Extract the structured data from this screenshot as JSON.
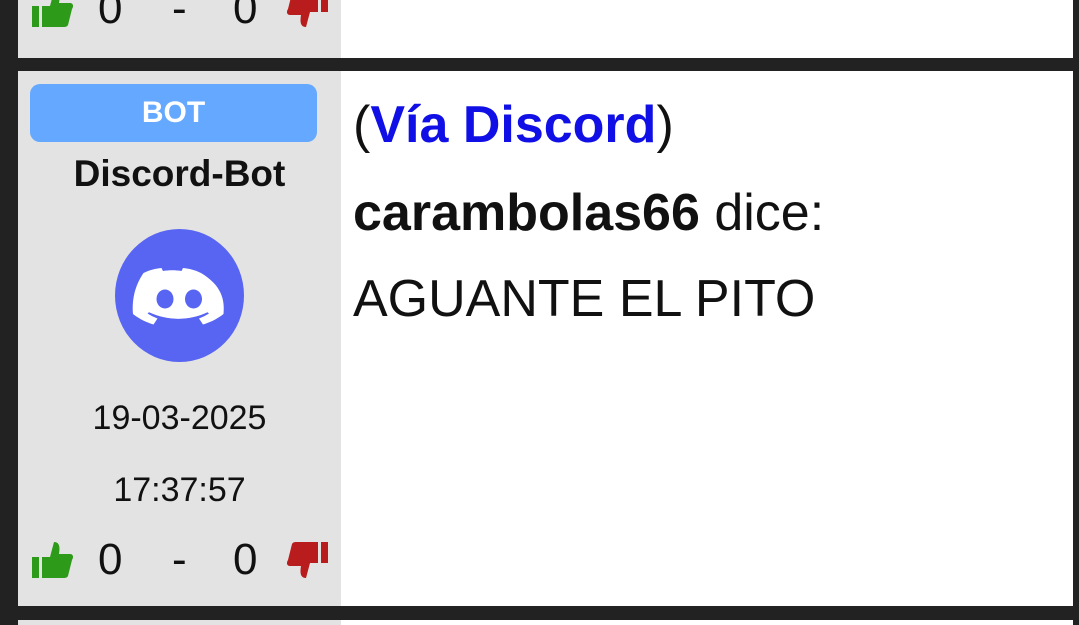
{
  "previous_post": {
    "likes": "0",
    "separator": "-",
    "dislikes": "0"
  },
  "post": {
    "badge": "BOT",
    "username": "Discord-Bot",
    "avatar_icon": "discord-logo-icon",
    "avatar_color": "#5865f2",
    "date": "19-03-2025",
    "time": "17:37:57",
    "likes": "0",
    "separator": "-",
    "dislikes": "0",
    "via_open": "(",
    "via_link": "Vía Discord",
    "via_close": ")",
    "author": "carambolas66",
    "says": " dice:",
    "message": "AGUANTE EL PITO"
  },
  "colors": {
    "badge": "#64a8ff",
    "link": "#1010e6",
    "like": "#2e9a1a",
    "dislike": "#b81c1c",
    "sidebar": "#e3e3e3",
    "frame": "#222222"
  }
}
